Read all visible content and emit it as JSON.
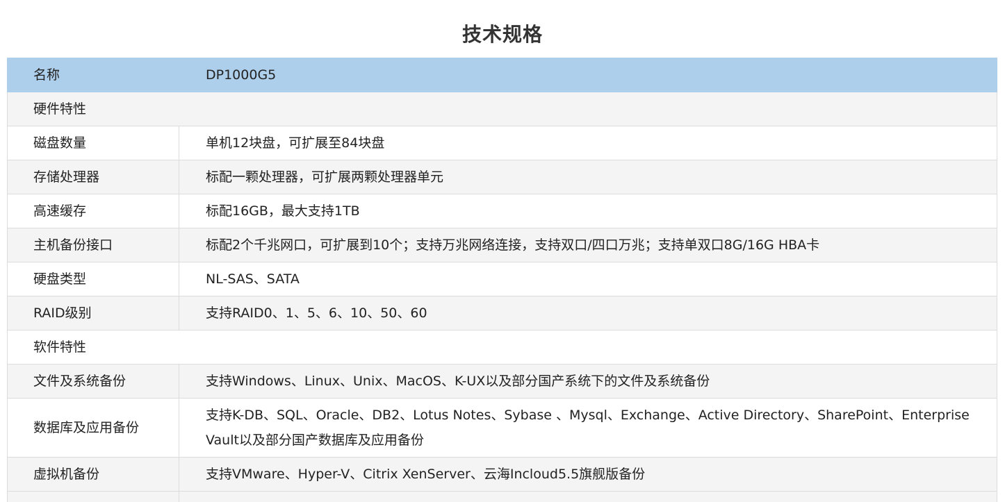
{
  "title": "技术规格",
  "table": {
    "header": {
      "key": "名称",
      "value": "DP1000G5"
    },
    "section_hardware": "硬件特性",
    "hardware_rows": [
      {
        "key": "磁盘数量",
        "value": "单机12块盘，可扩展至84块盘"
      },
      {
        "key": "存储处理器",
        "value": "标配一颗处理器，可扩展两颗处理器单元"
      },
      {
        "key": "高速缓存",
        "value": "标配16GB，最大支持1TB"
      },
      {
        "key": "主机备份接口",
        "value": "标配2个千兆网口，可扩展到10个；支持万兆网络连接，支持双口/四口万兆；支持单双口8G/16G HBA卡"
      },
      {
        "key": "硬盘类型",
        "value": "NL-SAS、SATA"
      },
      {
        "key": "RAID级别",
        "value": "支持RAID0、1、5、6、10、50、60"
      }
    ],
    "section_software": "软件特性",
    "software_rows": [
      {
        "key": "文件及系统备份",
        "value": "支持Windows、Linux、Unix、MacOS、K-UX以及部分国产系统下的文件及系统备份"
      },
      {
        "key": "数据库及应用备份",
        "value": "支持K-DB、SQL、Oracle、DB2、Lotus Notes、Sybase 、Mysql、Exchange、Active Directory、SharePoint、Enterprise Vault以及部分国产数据库及应用备份"
      },
      {
        "key": "虚拟机备份",
        "value": "支持VMware、Hyper-V、Citrix XenServer、云海Incloud5.5旗舰版备份"
      }
    ]
  }
}
